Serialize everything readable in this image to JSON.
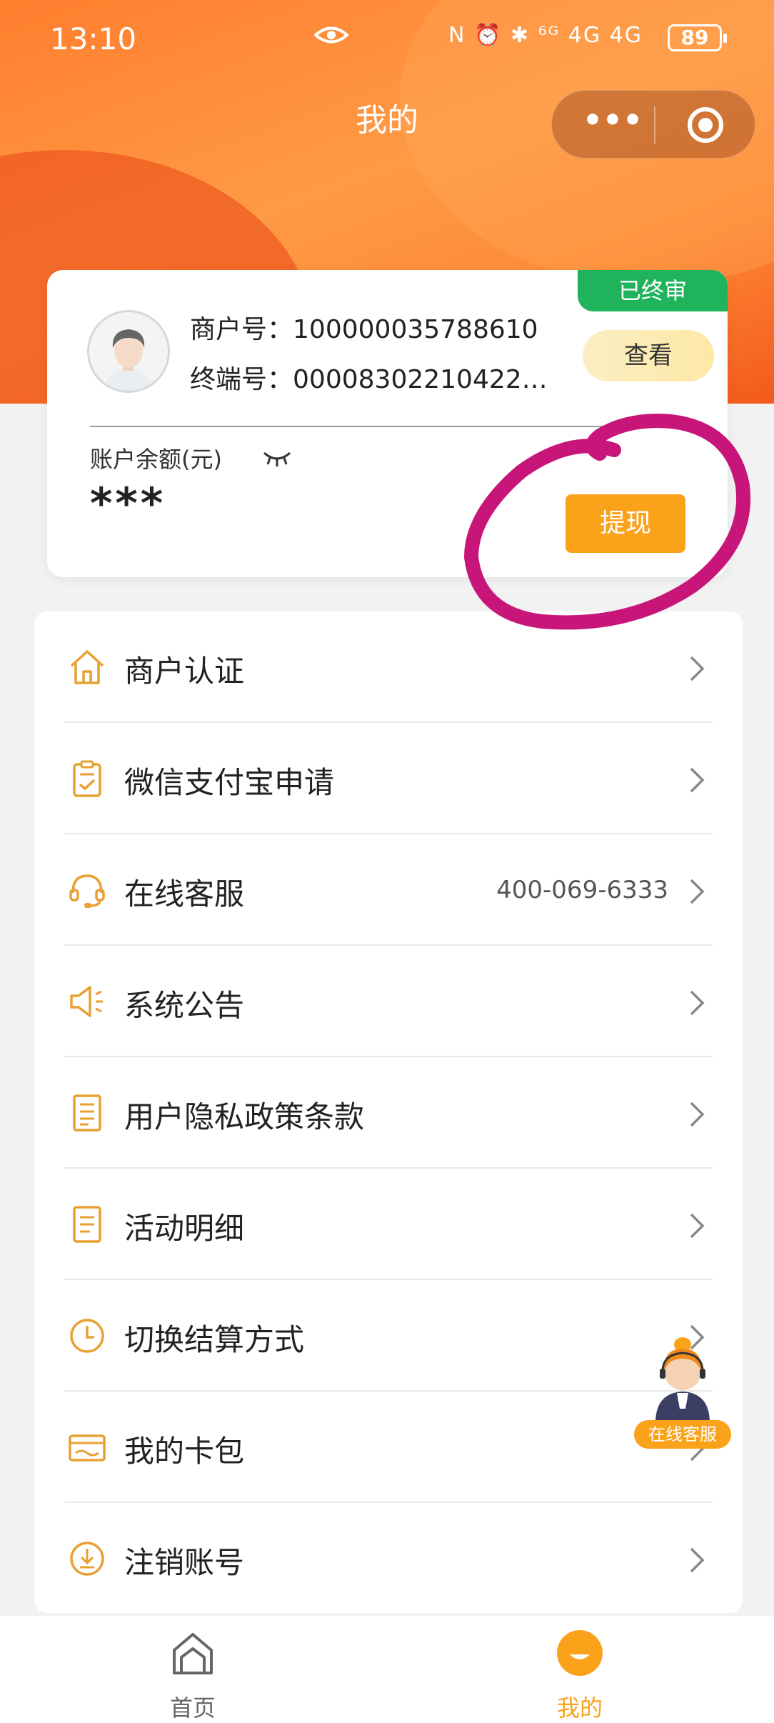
{
  "status_bar": {
    "time": "13:10",
    "icons": "N ⏰ ✱ ⁶ᴳ 4G 4G",
    "battery": "89"
  },
  "nav": {
    "title": "我的",
    "more_icon": "more-dots-icon",
    "close_icon": "target-circle-icon"
  },
  "merchant_card": {
    "status_badge": "已终审",
    "merchant_no_label": "商户号：",
    "merchant_no": "100000035788610",
    "terminal_no_label": "终端号：",
    "terminal_no": "00008302210422…",
    "view_button": "查看",
    "balance_label": "账户余额(元)",
    "balance_value": "***",
    "withdraw_button": "提现"
  },
  "menu": {
    "items": [
      {
        "label": "商户认证",
        "icon": "home-icon"
      },
      {
        "label": "微信支付宝申请",
        "icon": "clipboard-check-icon"
      },
      {
        "label": "在线客服",
        "icon": "headset-icon",
        "value": "400-069-6333"
      },
      {
        "label": "系统公告",
        "icon": "speaker-icon"
      },
      {
        "label": "用户隐私政策条款",
        "icon": "document-icon"
      },
      {
        "label": "活动明细",
        "icon": "list-document-icon"
      },
      {
        "label": "切换结算方式",
        "icon": "clock-icon"
      },
      {
        "label": "我的卡包",
        "icon": "card-wallet-icon"
      },
      {
        "label": "注销账号",
        "icon": "power-down-icon"
      }
    ]
  },
  "floating_service": {
    "label": "在线客服"
  },
  "tabbar": {
    "home": "首页",
    "mine": "我的"
  },
  "colors": {
    "accent": "#f9a21a",
    "header": "#ff8a36",
    "badge": "#1fb45c"
  }
}
